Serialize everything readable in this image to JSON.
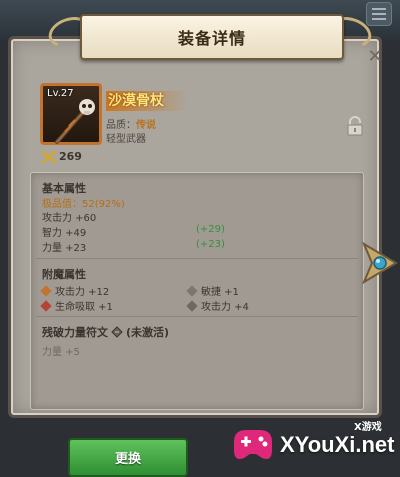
{
  "dialog": {
    "title": "装备详情"
  },
  "item": {
    "level": "Lv.27",
    "name": "沙漠骨杖",
    "quality_label": "品质：",
    "quality_value": "传说",
    "type": "轻型武器",
    "power": "269"
  },
  "basic_attributes": {
    "title": "基本属性",
    "quality_score": "极品值：52(92%)",
    "stats": [
      {
        "text": "攻击力 +60",
        "bonus": ""
      },
      {
        "text": "智力 +49",
        "bonus": "(+29)"
      },
      {
        "text": "力量 +23",
        "bonus": "(+23)"
      }
    ]
  },
  "enchant_attributes": {
    "title": "附魔属性",
    "stats": [
      "攻击力 +12",
      "敏捷 +1",
      "生命吸取 +1",
      "攻击力 +4"
    ]
  },
  "rune": {
    "title": "残破力量符文",
    "status": "(未激活)",
    "stat": "力量 +5"
  },
  "buttons": {
    "change": "更换"
  },
  "watermark": {
    "small": "X游戏",
    "text": "XYouXi.net"
  },
  "colors": {
    "panel": "#aaa59d",
    "legendary": "#c9781f",
    "green_button": "#3fa13f",
    "bonus_green": "#3c8d3c"
  },
  "icons": [
    "menu-icon",
    "close-icon",
    "staff-icon",
    "lock-icon",
    "power-icon",
    "rune-icon",
    "arrow-gem-icon",
    "gamepad-logo-icon"
  ]
}
